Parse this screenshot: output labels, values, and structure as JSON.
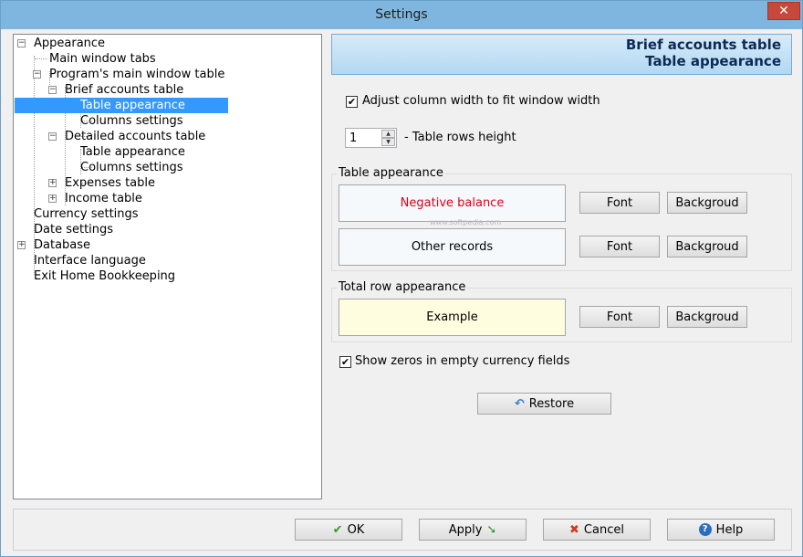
{
  "window": {
    "title": "Settings",
    "close_glyph": "✕"
  },
  "tree": {
    "items": [
      {
        "label": "Appearance",
        "expander": "−"
      },
      {
        "label": "Main window tabs"
      },
      {
        "label": "Program's main window table",
        "expander": "−"
      },
      {
        "label": "Brief accounts table",
        "expander": "−"
      },
      {
        "label": "Table appearance",
        "selected": true
      },
      {
        "label": "Columns settings"
      },
      {
        "label": "Detailed accounts table",
        "expander": "−"
      },
      {
        "label": "Table appearance"
      },
      {
        "label": "Columns settings"
      },
      {
        "label": "Expenses table",
        "expander": "+"
      },
      {
        "label": "Income table",
        "expander": "+"
      },
      {
        "label": "Currency settings"
      },
      {
        "label": "Date settings"
      },
      {
        "label": "Database",
        "expander": "+"
      },
      {
        "label": "Interface language"
      },
      {
        "label": "Exit Home Bookkeeping"
      }
    ]
  },
  "banner": {
    "line1": "Brief accounts table",
    "line2": "Table appearance"
  },
  "options": {
    "adjust_width": {
      "label": "Adjust column width to fit window width",
      "checked": true,
      "glyph": "✔"
    },
    "rows_height": {
      "value": "1",
      "label": "- Table rows height",
      "up": "▲",
      "down": "▼"
    },
    "show_zeros": {
      "label": "Show zeros in empty currency fields",
      "checked": true,
      "glyph": "✔"
    }
  },
  "table_appearance": {
    "title": "Table appearance",
    "negative": {
      "label": "Negative balance",
      "color": "#e0001a",
      "bg": "#f5f9fc"
    },
    "other": {
      "label": "Other records",
      "bg": "#f5f9fc"
    },
    "font_label": "Font",
    "background_label": "Backgroud"
  },
  "total_row": {
    "title": "Total row appearance",
    "example": {
      "label": "Example",
      "bg": "#fffde0"
    },
    "font_label": "Font",
    "background_label": "Backgroud"
  },
  "restore": {
    "label": "Restore",
    "icon": "↶"
  },
  "watermark": "www.softpedia.com",
  "footer": {
    "ok": {
      "label": "OK",
      "icon": "✔",
      "color": "#2e9a2e"
    },
    "apply": {
      "label": "Apply",
      "icon": "➘",
      "color": "#2e9a2e"
    },
    "cancel": {
      "label": "Cancel",
      "icon": "✖",
      "color": "#d23a1e"
    },
    "help": {
      "label": "Help",
      "icon": "?",
      "color": "#2a6fbf"
    }
  }
}
